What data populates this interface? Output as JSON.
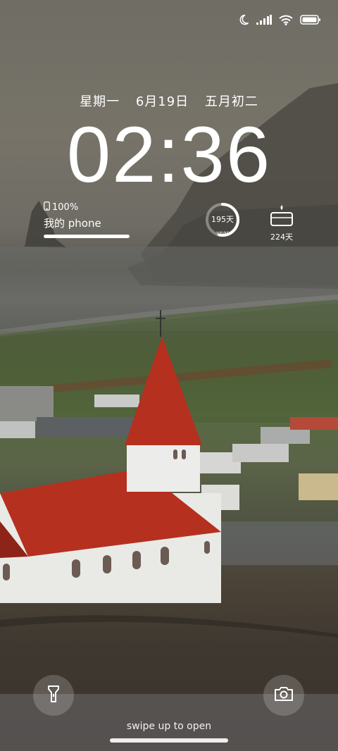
{
  "status_bar": {
    "icons": [
      "moon-icon",
      "signal-icon",
      "wifi-icon",
      "battery-icon"
    ]
  },
  "lockscreen": {
    "date": {
      "weekday": "星期一",
      "solar": "6月19日",
      "lunar": "五月初二"
    },
    "time": "02:36",
    "battery_widget": {
      "percent_text": "100%",
      "level": 1.0,
      "device_name": "我的 phone"
    },
    "year_widget": {
      "days_text": "195天",
      "label": "year",
      "progress": 0.53
    },
    "countdown_widget": {
      "days_text": "224天",
      "icon": "birthday-cake-icon"
    },
    "swipe_hint": "swipe up to open",
    "buttons": {
      "flashlight_icon": "flashlight-icon",
      "camera_icon": "camera-icon"
    }
  },
  "colors": {
    "accent": "#ffffff",
    "church_roof": "#b5301f"
  }
}
